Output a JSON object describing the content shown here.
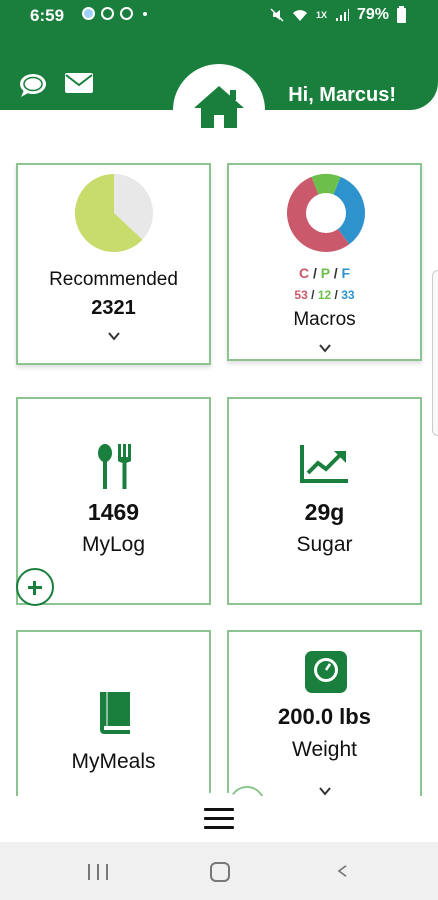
{
  "status_bar": {
    "time": "6:59",
    "battery": "79%",
    "network": "1X"
  },
  "header": {
    "greeting": "Hi, Marcus!",
    "brand_color": "#1a7f3c"
  },
  "cards": {
    "recommended": {
      "label": "Recommended",
      "value": "2321",
      "pie_fraction_consumed": 0.63,
      "pie_colors": [
        "#c7dc6a",
        "#e8e8e8"
      ]
    },
    "macros": {
      "label": "Macros",
      "c_letter": "C",
      "p_letter": "P",
      "f_letter": "F",
      "sep": "/",
      "c_value": "53",
      "p_value": "12",
      "f_value": "33",
      "donut": [
        {
          "name": "C",
          "value": 53,
          "color": "#c9596b"
        },
        {
          "name": "P",
          "value": 12,
          "color": "#6cbf4b"
        },
        {
          "name": "F",
          "value": 33,
          "color": "#2e93cc"
        }
      ]
    },
    "mylog": {
      "label": "MyLog",
      "value": "1469",
      "icon": "utensils-icon"
    },
    "sugar": {
      "label": "Sugar",
      "value": "29g",
      "icon": "trend-chart-icon"
    },
    "mymeals": {
      "label": "MyMeals",
      "icon": "book-icon"
    },
    "weight": {
      "label": "Weight",
      "value": "200.0 lbs",
      "icon": "scale-icon"
    }
  },
  "nav": {
    "menu_icon": "hamburger-icon",
    "system": [
      "recent-apps-icon",
      "home-icon",
      "back-icon"
    ]
  }
}
